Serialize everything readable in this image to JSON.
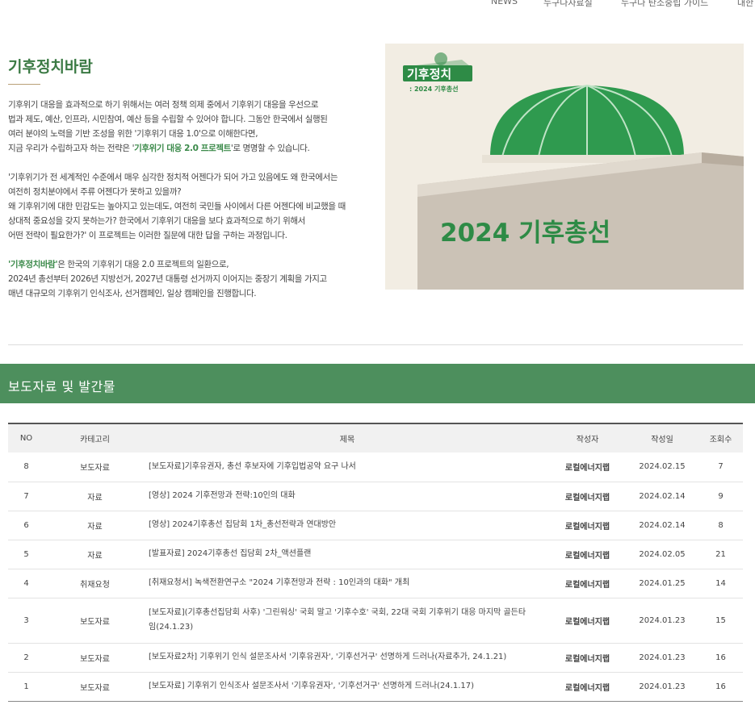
{
  "nav": {
    "items": [
      "NEWS",
      "누구나자료실",
      "누구나 탄소중립 가이드",
      "대한"
    ]
  },
  "intro": {
    "title": "기후정치바람",
    "p1_lines": [
      "기후위기 대응을 효과적으로 하기 위해서는 여러 정책 의제 중에서 기후위기 대응을 우선으로",
      "법과 제도, 예산, 인프라, 시민참여, 예산 등을 수립할 수 있어야 합니다. 그동안 한국에서 실행된",
      "여러 분야의 노력을 기반 조성을 위한 '기후위기 대응 1.0'으로 이해한다면,"
    ],
    "p1_last_before": "지금 우리가 수립하고자 하는 전략은 '",
    "p1_highlight": "기후위기 대응 2.0 프로젝트",
    "p1_last_after": "'로 명명할 수 있습니다.",
    "p2_lines": [
      " '기후위기가 전 세계적인 수준에서 매우 심각한 정치적 어젠다가 되어 가고 있음에도 왜 한국에서는",
      "여전히 정치분야에서 주류 어젠다가 못하고 있을까?",
      "왜 기후위기에 대한 민감도는 높아지고 있는데도, 여전히 국민들 사이에서 다른 어젠다에 비교했을 때",
      "상대적 중요성을 갖지 못하는가? 한국에서 기후위기 대응을 보다 효과적으로 하기 위해서",
      "어떤 전략이 필요한가?' 이 프로젝트는 이러한 질문에 대한 답을 구하는 과정입니다."
    ],
    "p3_highlight": "'기후정치바람'",
    "p3_first_after": "은 한국의 기후위기 대응 2.0 프로젝트의 일환으로,",
    "p3_lines": [
      "2024년 총선부터 2026년 지방선거, 2027년 대통령 선거까지 이어지는 중장기 계획을 가지고",
      "매년 대규모의 기후위기 인식조사, 선거캠페인, 일상 캠페인을 진행합니다."
    ]
  },
  "poster": {
    "logo_text": "기후정치",
    "logo_sub": ": 2024 기후총선",
    "headline": "2024 기후총선",
    "colors": {
      "green": "#2e8b46",
      "dome": "#2f9a4f",
      "wall": "#c9bfb3",
      "bg": "#f2ede3"
    }
  },
  "section": {
    "title": "보도자료  및 발간물"
  },
  "table": {
    "headers": [
      "NO",
      "카테고리",
      "제목",
      "작성자",
      "작성일",
      "조회수"
    ],
    "rows": [
      {
        "no": "8",
        "category": "보도자료",
        "title": "[보도자료]기후유권자, 총선 후보자에 기후입법공약 요구 나서",
        "author": "로컬에너지랩",
        "date": "2024.02.15",
        "views": "7"
      },
      {
        "no": "7",
        "category": "자료",
        "title": "[영상] 2024 기후전망과 전략:10인의 대화",
        "author": "로컬에너지랩",
        "date": "2024.02.14",
        "views": "9"
      },
      {
        "no": "6",
        "category": "자료",
        "title": "[영상] 2024기후총선 집담회 1차_총선전략과 연대방안",
        "author": "로컬에너지랩",
        "date": "2024.02.14",
        "views": "8"
      },
      {
        "no": "5",
        "category": "자료",
        "title": "[발표자료] 2024기후총선 집담회 2차_액션플랜",
        "author": "로컬에너지랩",
        "date": "2024.02.05",
        "views": "21"
      },
      {
        "no": "4",
        "category": "취재요청",
        "title": "[취재요청서] 녹색전환연구소 \"2024 기후전망과 전략 : 10인과의 대화\" 개최",
        "author": "로컬에너지랩",
        "date": "2024.01.25",
        "views": "14"
      },
      {
        "no": "3",
        "category": "보도자료",
        "title": "[보도자료](기후총선집담회 사후) '그린워싱' 국회 말고 '기후수호' 국회, 22대 국회 기후위기 대응 마지막 골든타임(24.1.23)",
        "author": "로컬에너지랩",
        "date": "2024.01.23",
        "views": "15"
      },
      {
        "no": "2",
        "category": "보도자료",
        "title": "[보도자료2차] 기후위기 인식 설문조사서 '기후유권자', '기후선거구' 선명하게 드러나(자료추가, 24.1.21)",
        "author": "로컬에너지랩",
        "date": "2024.01.23",
        "views": "16"
      },
      {
        "no": "1",
        "category": "보도자료",
        "title": "[보도자료] 기후위기 인식조사 설문조사서 '기후유권자', '기후선거구' 선명하게 드러나(24.1.17)",
        "author": "로컬에너지랩",
        "date": "2024.01.23",
        "views": "16"
      }
    ]
  }
}
